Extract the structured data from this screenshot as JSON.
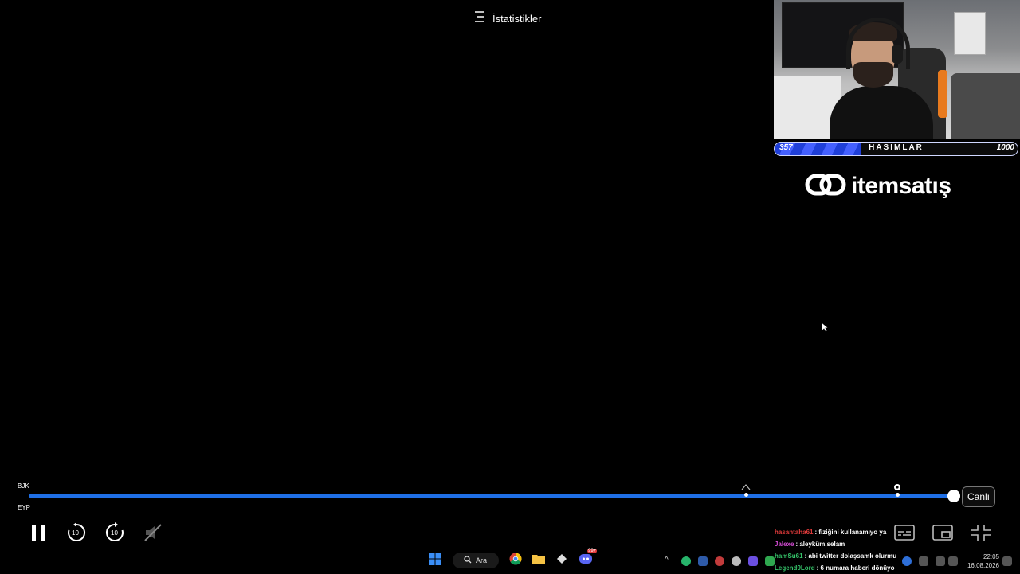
{
  "player": {
    "stats_label": "İstatistikler",
    "team_top": "BJK",
    "team_bottom": "EYP",
    "live_label": "Canlı",
    "rewind_label": "10",
    "forward_label": "10"
  },
  "overlay": {
    "goal": {
      "current": "357",
      "title": "HASIMLAR",
      "max": "1000",
      "progress": 0.357,
      "fill_color": "#2f4df0"
    },
    "sponsor": "itemsatış"
  },
  "chat": {
    "messages": [
      {
        "user": "hasantaha61",
        "text": ": fiziğini kullanamıyo ya",
        "user_color": "#e23b3b"
      },
      {
        "user": "Jalexe",
        "text": ": aleyküm.selam",
        "user_color": "#d34bd3"
      },
      {
        "user": "hamSu61",
        "text": ": abi twitter dolaşsamk olurmu",
        "user_color": "#35c46a"
      },
      {
        "user": "Legend9Lord",
        "text": ": 6 numara haberi dönüyo",
        "user_color": "#35c46a"
      }
    ]
  },
  "taskbar": {
    "search_label": "Ara",
    "discord_badge": "99+",
    "time": "22:05",
    "date": "16.08.2026"
  },
  "colors": {
    "accent": "#1f6fe6",
    "background": "#000000"
  },
  "icons": [
    "stats-menu-icon",
    "pause-icon",
    "rewind-10-icon",
    "forward-10-icon",
    "muted-icon",
    "subtitles-icon",
    "cast-icon",
    "exit-fullscreen-icon",
    "windows-start-icon",
    "chrome-icon",
    "folder-icon",
    "discord-icon"
  ]
}
